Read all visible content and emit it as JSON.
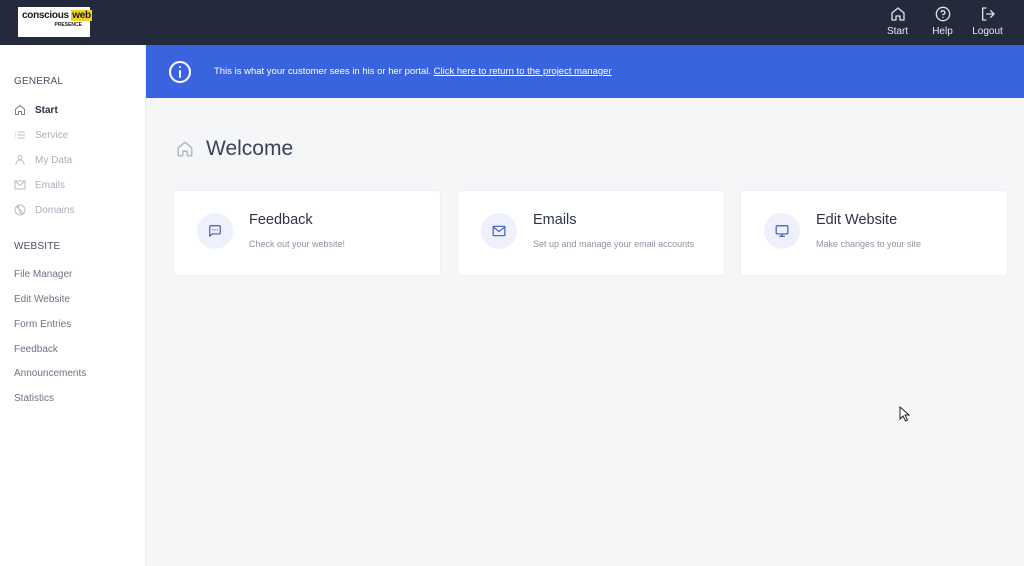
{
  "topbar": {
    "logo": {
      "line1_a": "conscious",
      "line1_b": "web",
      "line2": "PRESENCE"
    },
    "actions": [
      {
        "label": "Start",
        "icon": "home-icon"
      },
      {
        "label": "Help",
        "icon": "help-circle-icon"
      },
      {
        "label": "Logout",
        "icon": "logout-icon"
      }
    ]
  },
  "sidebar": {
    "general_title": "GENERAL",
    "general_items": [
      {
        "label": "Start",
        "icon": "home-icon",
        "active": true
      },
      {
        "label": "Service",
        "icon": "list-icon"
      },
      {
        "label": "My Data",
        "icon": "user-icon"
      },
      {
        "label": "Emails",
        "icon": "mail-icon"
      },
      {
        "label": "Domains",
        "icon": "globe-icon"
      }
    ],
    "website_title": "WEBSITE",
    "website_items": [
      {
        "label": "File Manager"
      },
      {
        "label": "Edit Website"
      },
      {
        "label": "Form Entries"
      },
      {
        "label": "Feedback"
      },
      {
        "label": "Announcements"
      },
      {
        "label": "Statistics"
      }
    ]
  },
  "banner": {
    "text": "This is what your customer sees in his or her portal.",
    "link": "Click here to return to the project manager",
    "color": "#3a63df"
  },
  "main": {
    "title": "Welcome",
    "cards": [
      {
        "title": "Feedback",
        "description": "Check out your website!",
        "icon": "chat-icon"
      },
      {
        "title": "Emails",
        "description": "Set up and manage your email accounts",
        "icon": "mail-icon"
      },
      {
        "title": "Edit Website",
        "description": "Make changes to your site",
        "icon": "monitor-icon"
      }
    ]
  },
  "colors": {
    "topbar": "#232a3b",
    "accent": "#3e5bbf",
    "background": "#f5f6f8"
  }
}
